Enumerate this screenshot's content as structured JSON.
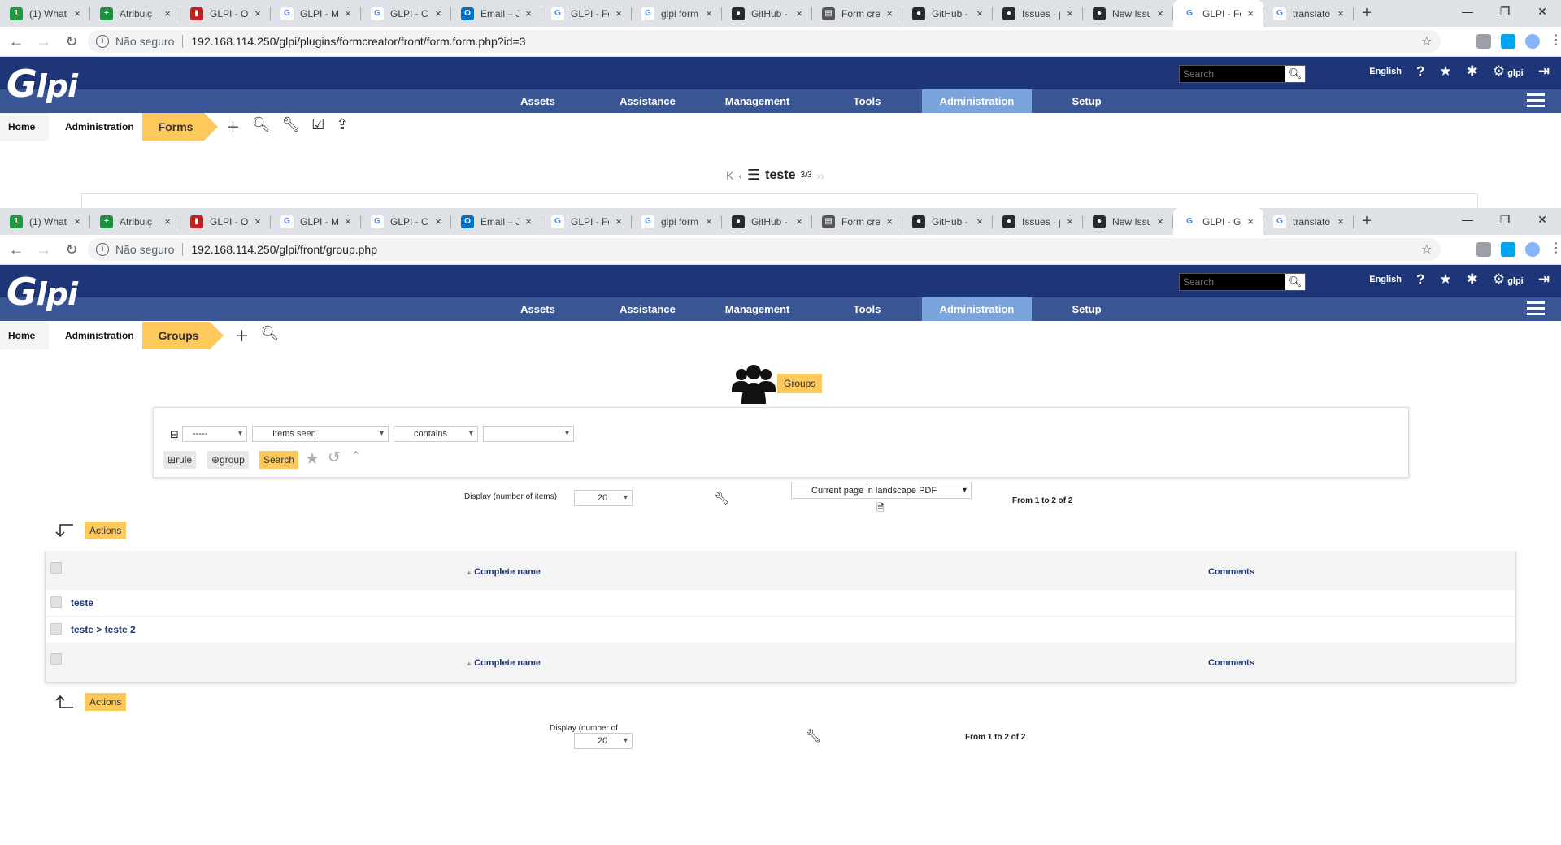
{
  "browser": {
    "tabs_top": [
      "(1) What",
      "Atribuiç",
      "GLPI - O",
      "GLPI - M",
      "GLPI - Cl",
      "Email – J",
      "GLPI - Fo",
      "glpi form",
      "GitHub -",
      "Form cre",
      "GitHub -",
      "Issues · p",
      "New Issu",
      "GLPI - Fo",
      "translato"
    ],
    "tabs_bottom": [
      "(1) What",
      "Atribuiç",
      "GLPI - O",
      "GLPI - M",
      "GLPI - Cl",
      "Email – J",
      "GLPI - Fo",
      "glpi form",
      "GitHub -",
      "Form cre",
      "GitHub -",
      "Issues · p",
      "New Issu",
      "GLPI - G",
      "translato"
    ],
    "insecure_label": "Não seguro",
    "url_top": "192.168.114.250/glpi/plugins/formcreator/front/form.form.php?id=3",
    "url_bottom": "192.168.114.250/glpi/front/group.php",
    "newtab": "+",
    "close": "×"
  },
  "header": {
    "logo": "Glpi",
    "search_placeholder": "Search",
    "language": "English",
    "user": "glpi",
    "menu": [
      "Assets",
      "Assistance",
      "Management",
      "Tools",
      "Administration",
      "Setup"
    ]
  },
  "crumbs_top": {
    "home": "Home",
    "admin": "Administration",
    "current": "Forms"
  },
  "crumbs_bottom": {
    "home": "Home",
    "admin": "Administration",
    "current": "Groups"
  },
  "form_pager": {
    "name": "teste",
    "count": "3/3"
  },
  "groups_page": {
    "title": "Groups",
    "criteria": {
      "field0": "-----",
      "field1": "Items seen",
      "operator": "contains",
      "value": ""
    },
    "btn_rule": "rule",
    "btn_group": "group",
    "btn_search": "Search",
    "display_label": "Display (number of items)",
    "display_label_line1": "Display (number of",
    "display_label_line2": "items)",
    "display_value": "20",
    "export_option": "Current page in landscape PDF",
    "from_to": "From 1 to 2 of 2",
    "actions": "Actions",
    "col_name": "Complete name",
    "col_comments": "Comments",
    "rows": [
      "teste",
      "teste > teste 2"
    ]
  }
}
